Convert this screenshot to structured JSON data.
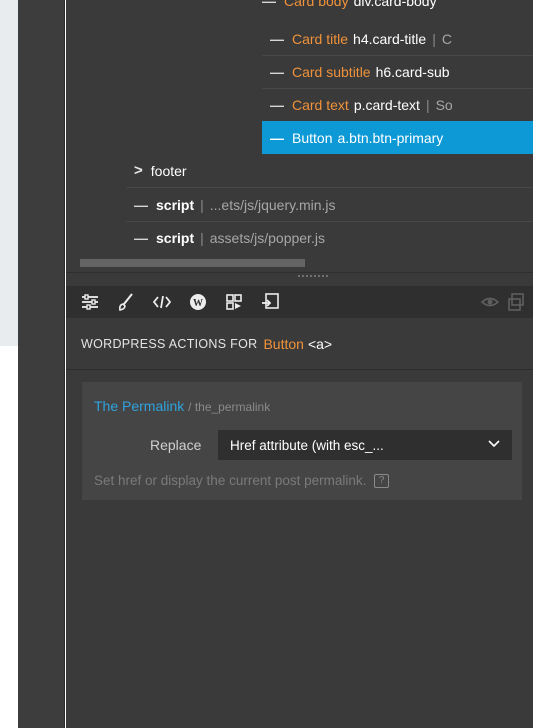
{
  "tree": {
    "rows": [
      {
        "dash": "—",
        "name": "Card title",
        "tag": "h4.card-title",
        "sep": "|",
        "extra": "C"
      },
      {
        "dash": "—",
        "name": "Card subtitle",
        "tag": "h6.card-sub",
        "sep": "",
        "extra": ""
      },
      {
        "dash": "—",
        "name": "Card text",
        "tag": "p.card-text",
        "sep": "|",
        "extra": "So"
      },
      {
        "dash": "—",
        "name": "Button",
        "tag": "a.btn.btn-primary",
        "sep": "",
        "extra": ""
      }
    ],
    "footer": {
      "chevron": ">",
      "label": "footer"
    },
    "scripts": [
      {
        "dash": "—",
        "label": "script",
        "sep": "|",
        "src": "...ets/js/jquery.min.js"
      },
      {
        "dash": "—",
        "label": "script",
        "sep": "|",
        "src": "assets/js/popper.js"
      }
    ]
  },
  "toolbar": {
    "icons": [
      "sliders-icon",
      "brush-icon",
      "code-icon",
      "wordpress-icon",
      "components-icon",
      "import-icon"
    ],
    "right_icons": [
      "eye-icon",
      "duplicate-icon"
    ]
  },
  "actions": {
    "header_prefix": "WORDPRESS ACTIONS FOR",
    "element_name": "Button",
    "element_tag": "<a>"
  },
  "action_card": {
    "title": "The Permalink",
    "func": "/ the_permalink",
    "replace_label": "Replace",
    "select_value": "Href attribute (with esc_...",
    "help_text": "Set href or display the current post permalink.",
    "help_icon": "?"
  },
  "colors": {
    "accent": "#0d99d6",
    "orange": "#f0923a",
    "panel_bg": "#3a3a3a"
  }
}
